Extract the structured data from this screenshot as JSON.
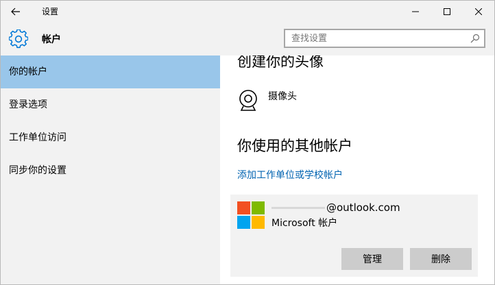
{
  "window": {
    "title": "设置",
    "icons": {
      "back": "back-arrow-icon",
      "minimize": "minimize-icon",
      "maximize": "maximize-icon",
      "close": "close-icon"
    }
  },
  "header": {
    "title": "帐户",
    "icon": "gear-icon",
    "accent_color": "#0078d7"
  },
  "search": {
    "placeholder": "查找设置",
    "value": ""
  },
  "sidebar": {
    "selected_color": "#99c6ea",
    "items": [
      {
        "label": "你的帐户",
        "selected": true
      },
      {
        "label": "登录选项",
        "selected": false
      },
      {
        "label": "工作单位访问",
        "selected": false
      },
      {
        "label": "同步你的设置",
        "selected": false
      }
    ]
  },
  "main": {
    "avatar_section_title": "创建你的头像",
    "camera_label": "摄像头",
    "other_accounts_title": "你使用的其他帐户",
    "add_link": "添加工作单位或学校帐户",
    "link_color": "#0063b1",
    "account": {
      "email_suffix": "@outlook.com",
      "type": "Microsoft 帐户",
      "manage_label": "管理",
      "delete_label": "删除"
    }
  }
}
